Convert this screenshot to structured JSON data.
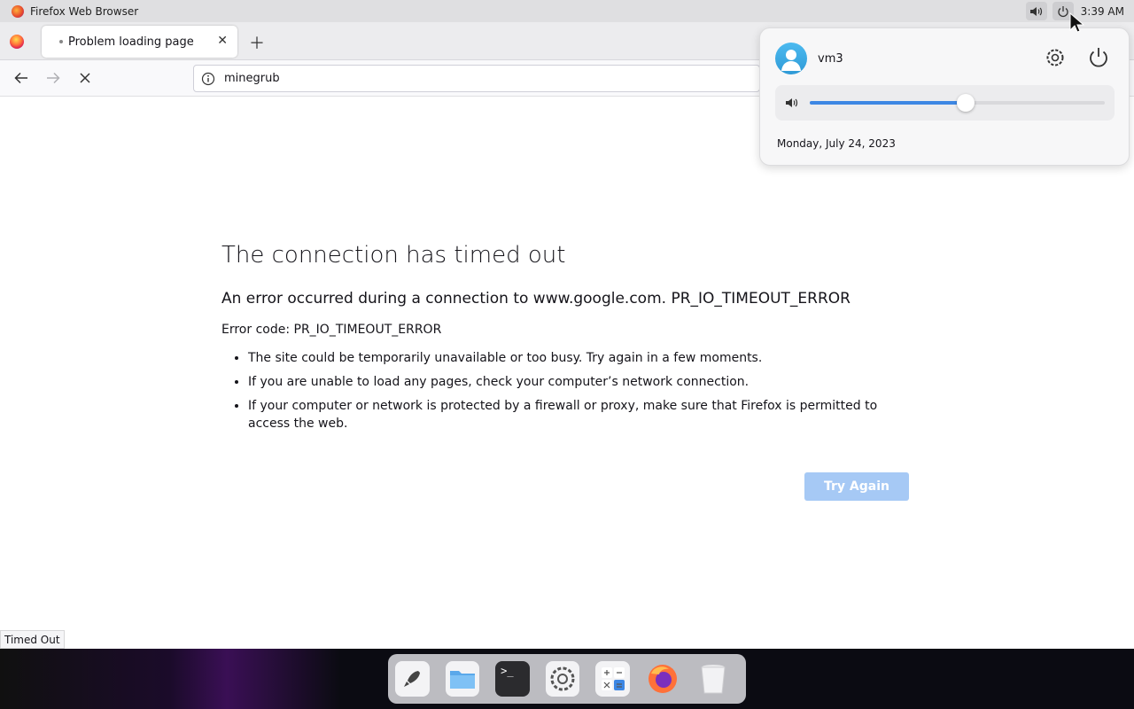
{
  "system_bar": {
    "app_name": "Firefox Web Browser",
    "clock": "3:39 AM",
    "volume_icon": "speaker-icon",
    "power_icon": "power-icon"
  },
  "browser": {
    "tab_title": "Problem loading page",
    "url": "minegrub",
    "status_text": "Timed Out"
  },
  "error_page": {
    "title": "The connection has timed out",
    "subtitle": "An error occurred during a connection to www.google.com. PR_IO_TIMEOUT_ERROR",
    "error_code": "Error code: PR_IO_TIMEOUT_ERROR",
    "bullets": [
      "The site could be temporarily unavailable or too busy. Try again in a few moments.",
      "If you are unable to load any pages, check your computer’s network connection.",
      "If your computer or network is protected by a firewall or proxy, make sure that Firefox is permitted to access the web."
    ],
    "try_again_label": "Try Again"
  },
  "system_menu": {
    "username": "vm3",
    "volume_level": 0.53,
    "date": "Monday, July 24, 2023"
  },
  "dock": {
    "items": [
      "launcher-icon",
      "files-icon",
      "terminal-icon",
      "settings-icon",
      "calculator-icon",
      "firefox-icon",
      "trash-icon"
    ]
  },
  "colors": {
    "accent": "#3d87e4",
    "try_again_bg": "#a6c9f5"
  }
}
